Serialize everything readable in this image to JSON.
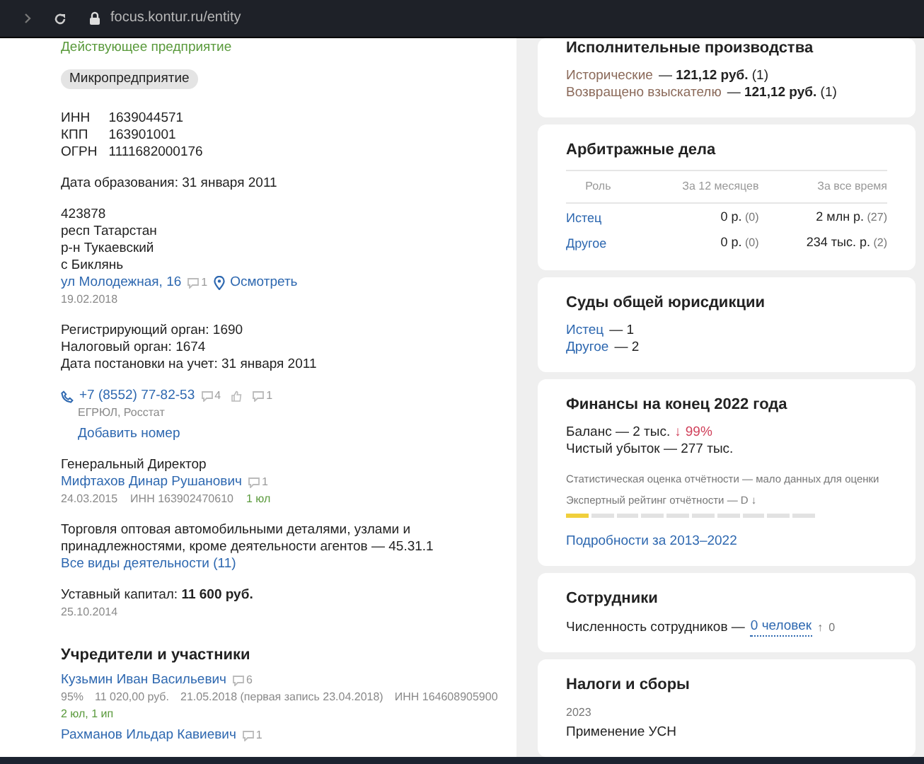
{
  "browser": {
    "url": "focus.kontur.ru/entity"
  },
  "company": {
    "status": "Действующее предприятие",
    "badge": "Микропредприятие",
    "ids": [
      {
        "label": "ИНН",
        "value": "1639044571"
      },
      {
        "label": "КПП",
        "value": "163901001"
      },
      {
        "label": "ОГРН",
        "value": "1111682000176"
      }
    ],
    "founded": "Дата образования: 31 января 2011",
    "address_lines": [
      "423878",
      "респ Татарстан",
      "р-н Тукаевский",
      "с Биклянь"
    ],
    "street": {
      "text": "ул Молодежная, 16",
      "comments": "1",
      "map_link": "Осмотреть",
      "date": "19.02.2018"
    },
    "registration": [
      "Регистрирующий орган: 1690",
      "Налоговый орган: 1674",
      "Дата постановки на учет: 31 января 2011"
    ],
    "phone": {
      "number": "+7 (8552) 77-82-53",
      "comments": "4",
      "dislikes": "1",
      "source": "ЕГРЮЛ, Росстат",
      "add_link": "Добавить номер"
    },
    "director": {
      "title": "Генеральный Директор",
      "name": "Мифтахов Динар Рушанович",
      "comments": "1",
      "date": "24.03.2015",
      "inn": "ИНН 163902470610",
      "links": "1 юл"
    },
    "activity": {
      "text": "Торговля оптовая автомобильными деталями, узлами и принадлежностями, кроме деятельности агентов — 45.31.1",
      "link": "Все виды деятельности (11)"
    },
    "capital": {
      "text": "Уставный капитал: **11 600 руб.**",
      "date": "25.10.2014"
    }
  },
  "founders": {
    "title": "Учредители и участники",
    "items": [
      {
        "name": "Кузьмин Иван Васильевич",
        "comments": "6",
        "details": [
          "95%",
          "11 020,00 руб.",
          "21.05.2018 (первая запись 23.04.2018)",
          "ИНН 164608905900"
        ],
        "links": "2 юл, 1 ип"
      },
      {
        "name": "Рахманов Ильдар Кавиевич",
        "comments": "1"
      }
    ]
  },
  "enforcement": {
    "title": "Исполнительные производства",
    "items": [
      {
        "label": "Исторические",
        "value": "— **121,12 руб.** (1)"
      },
      {
        "label": "Возвращено взыскателю",
        "value": "— **121,12 руб.** (1)"
      }
    ]
  },
  "arbitration": {
    "title": "Арбитражные дела",
    "columns": [
      "Роль",
      "За 12 месяцев",
      "За все время"
    ],
    "rows": [
      {
        "role": "Истец",
        "last_12": "0 р.",
        "last_12_count": "(0)",
        "all_time": "2 млн р.",
        "all_time_count": "(27)"
      },
      {
        "role": "Другое",
        "last_12": "0 р.",
        "last_12_count": "(0)",
        "all_time": "234 тыс. р.",
        "all_time_count": "(2)"
      }
    ]
  },
  "courts": {
    "title": "Суды общей юрисдикции",
    "items": [
      {
        "label": "Истец",
        "value": "— 1"
      },
      {
        "label": "Другое",
        "value": "— 2"
      }
    ]
  },
  "finances": {
    "title": "Финансы на конец 2022 года",
    "lines": [
      {
        "text": "Баланс — 2 тыс.",
        "arrow": "↓",
        "change": "99%"
      },
      {
        "text": "Чистый убыток — 277 тыс."
      }
    ],
    "stat_note": "Статистическая оценка отчётности — мало данных для оценки",
    "rating": "Экспертный рейтинг отчётности — D",
    "rating_arrow": "↓",
    "level": 0.1,
    "link": "Подробности за 2013–2022"
  },
  "employees": {
    "title": "Сотрудники",
    "label": "Численность сотрудников —",
    "count": "0 человек",
    "arrow": "↑",
    "change": "0"
  },
  "taxes": {
    "title": "Налоги и сборы",
    "year": "2023",
    "regime": "Применение УСН"
  }
}
